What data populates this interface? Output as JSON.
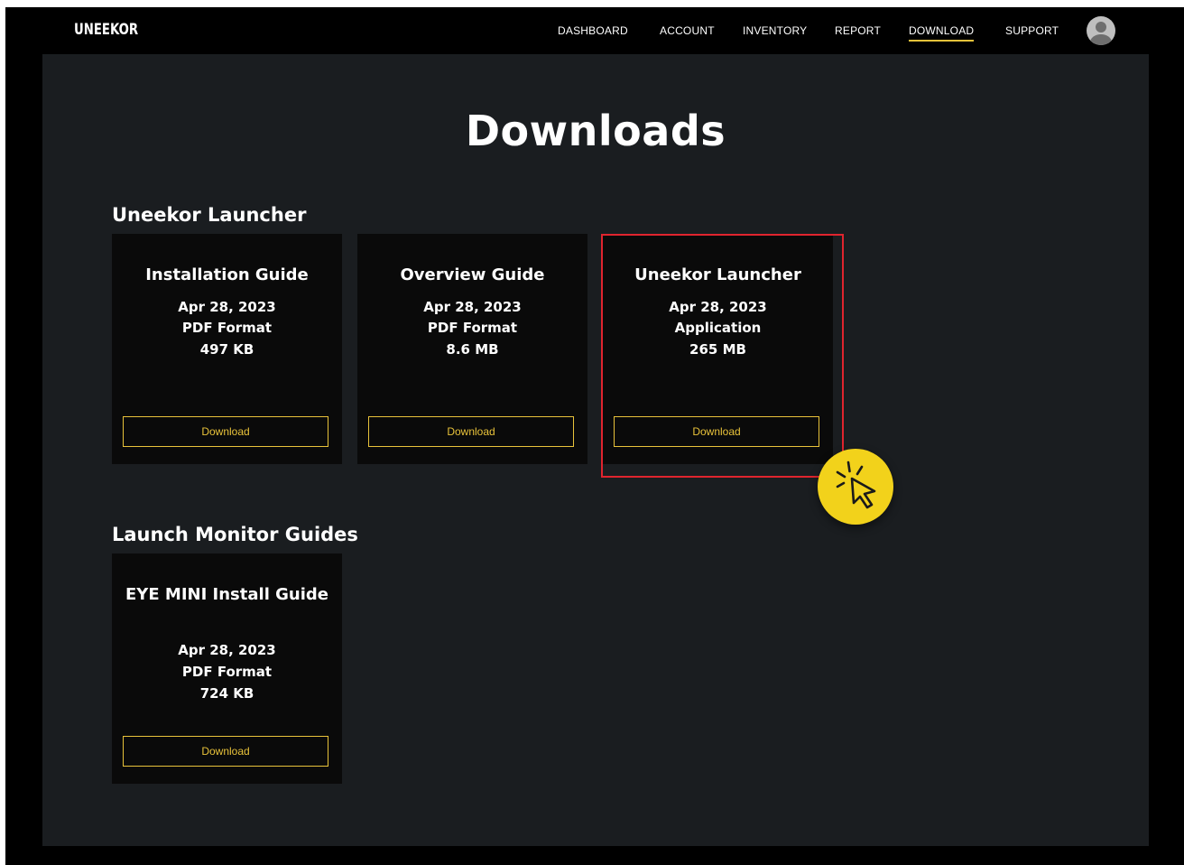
{
  "brand": "UNEEKOR",
  "nav": {
    "items": [
      {
        "label": "DASHBOARD"
      },
      {
        "label": "ACCOUNT"
      },
      {
        "label": "INVENTORY"
      },
      {
        "label": "REPORT"
      },
      {
        "label": "DOWNLOAD",
        "active": true
      },
      {
        "label": "SUPPORT"
      }
    ]
  },
  "page": {
    "title": "Downloads"
  },
  "sections": [
    {
      "title": "Uneekor Launcher",
      "cards": [
        {
          "name": "Installation Guide",
          "date": "Apr 28, 2023",
          "format": "PDF Format",
          "size": "497 KB",
          "button": "Download"
        },
        {
          "name": "Overview Guide",
          "date": "Apr 28, 2023",
          "format": "PDF Format",
          "size": "8.6 MB",
          "button": "Download"
        },
        {
          "name": "Uneekor Launcher",
          "date": "Apr 28, 2023",
          "format": "Application",
          "size": "265 MB",
          "button": "Download",
          "highlighted": true
        }
      ]
    },
    {
      "title": "Launch Monitor Guides",
      "cards": [
        {
          "name": "EYE MINI Install Guide",
          "date": "Apr 28, 2023",
          "format": "PDF Format",
          "size": "724 KB",
          "button": "Download"
        }
      ]
    }
  ],
  "icons": {
    "avatar": "user-avatar-icon",
    "click": "cursor-click-icon"
  },
  "colors": {
    "accent": "#e8c23a",
    "highlight": "#e0242e",
    "badge": "#f2d21b"
  }
}
